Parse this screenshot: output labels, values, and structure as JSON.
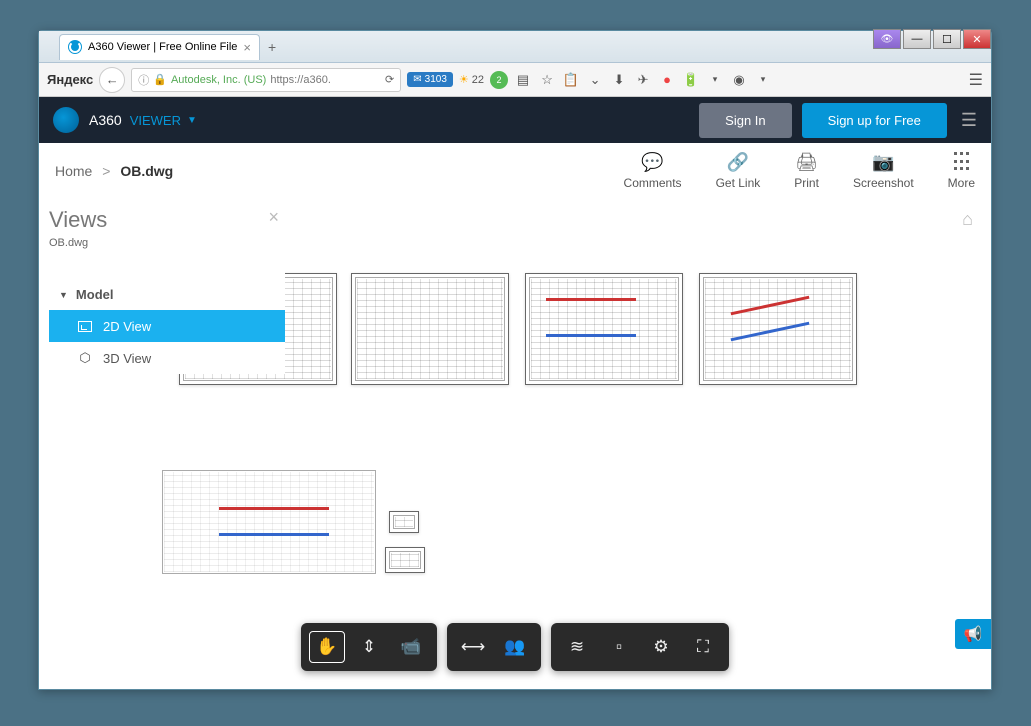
{
  "browser": {
    "tab_title": "A360 Viewer | Free Online File",
    "search_engine": "Яндекс",
    "cert_name": "Autodesk, Inc. (US)",
    "url": "https://a360.",
    "mail_count": "3103",
    "weather_temp": "22"
  },
  "app": {
    "brand": "A360",
    "mode": "VIEWER",
    "signin": "Sign In",
    "signup": "Sign up for Free"
  },
  "breadcrumb": {
    "home": "Home",
    "current": "OB.dwg"
  },
  "actions": {
    "comments": "Comments",
    "getlink": "Get Link",
    "print": "Print",
    "screenshot": "Screenshot",
    "more": "More"
  },
  "sidebar": {
    "title": "Views",
    "file": "OB.dwg",
    "model_label": "Model",
    "view_2d": "2D View",
    "view_3d": "3D View"
  }
}
